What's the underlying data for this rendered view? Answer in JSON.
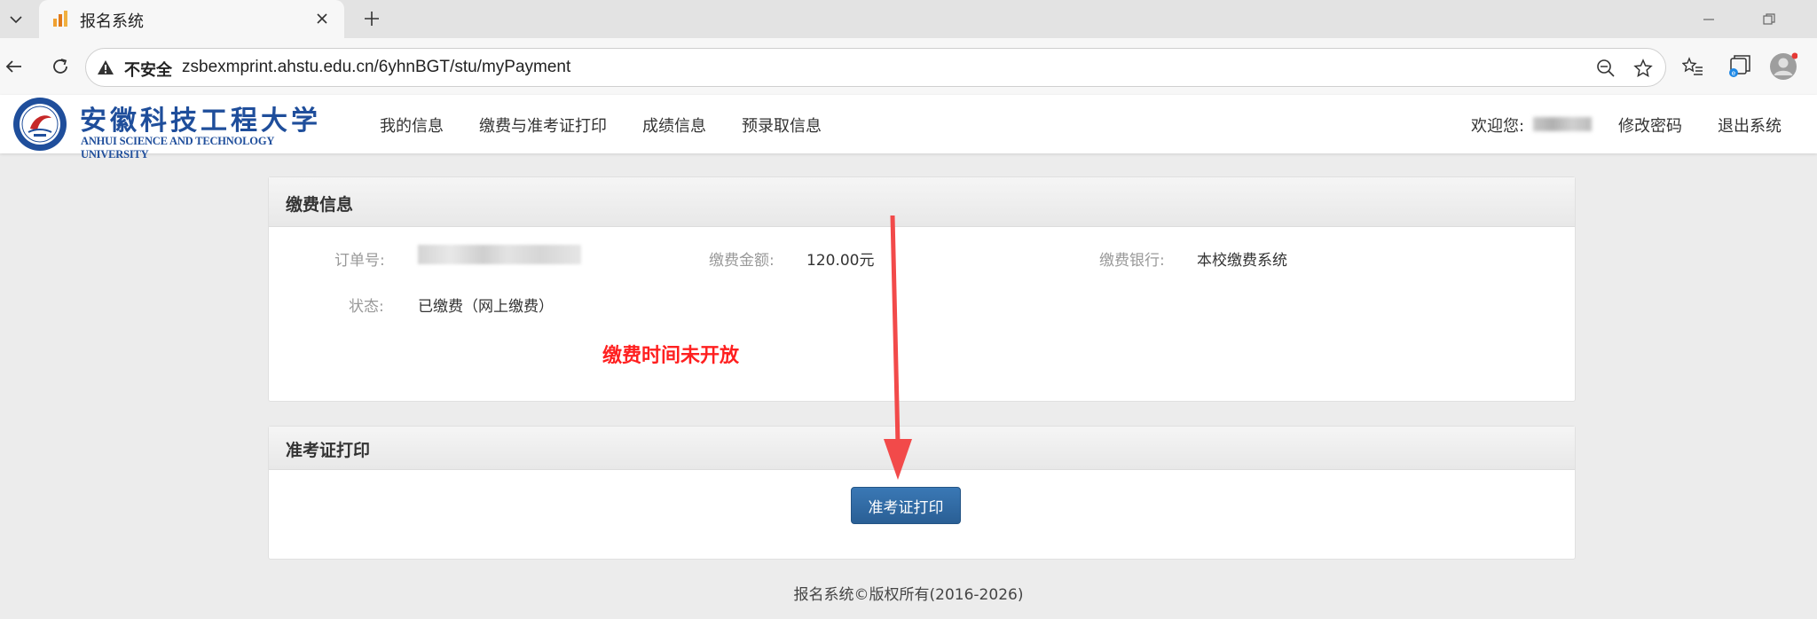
{
  "browser": {
    "tab_title": "报名系统",
    "insecure_label": "不安全",
    "url": "zsbexmprint.ahstu.edu.cn/6yhnBGT/stu/myPayment"
  },
  "site": {
    "logo_cn": "安徽科技工程大学",
    "logo_en": "ANHUI SCIENCE AND TECHNOLOGY UNIVERSITY",
    "nav": [
      "我的信息",
      "缴费与准考证打印",
      "成绩信息",
      "预录取信息"
    ],
    "welcome": "欢迎您:",
    "change_password": "修改密码",
    "logout": "退出系统"
  },
  "payment": {
    "title": "缴费信息",
    "order_label": "订单号:",
    "amount_label": "缴费金额:",
    "amount_value": "120.00元",
    "bank_label": "缴费银行:",
    "bank_value": "本校缴费系统",
    "status_label": "状态:",
    "status_value": "已缴费（网上缴费）",
    "notice": "缴费时间未开放"
  },
  "admit_card": {
    "title": "准考证打印",
    "button": "准考证打印"
  },
  "footer": "报名系统©版权所有(2016-2026)",
  "colors": {
    "brand_blue": "#1f4e9b",
    "notice_red": "#ff1f1f",
    "button_blue": "#2d6aa3",
    "arrow_red": "#f24a4a"
  }
}
